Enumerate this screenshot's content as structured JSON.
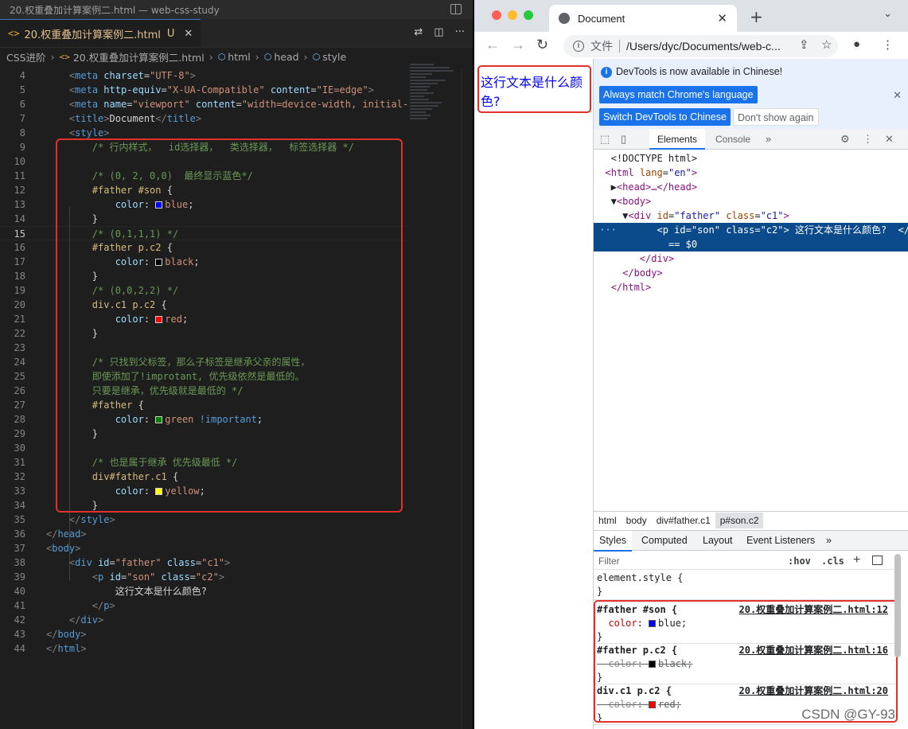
{
  "vscode": {
    "window_title": "20.权重叠加计算案例二.html — web-css-study",
    "tab": {
      "label": "20.权重叠加计算案例二.html",
      "status": "U",
      "icon": "<>"
    },
    "breadcrumb": [
      "CSS进阶",
      "20.权重叠加计算案例二.html",
      "html",
      "head",
      "style"
    ],
    "line_numbers": [
      "4",
      "5",
      "6",
      "7",
      "8",
      "9",
      "10",
      "11",
      "12",
      "13",
      "14",
      "15",
      "16",
      "17",
      "18",
      "19",
      "20",
      "21",
      "22",
      "23",
      "24",
      "25",
      "26",
      "27",
      "28",
      "29",
      "30",
      "31",
      "32",
      "33",
      "34",
      "35",
      "36",
      "37",
      "38",
      "39",
      "40",
      "41",
      "42",
      "43",
      "44"
    ],
    "code": {
      "l4_attr": "charset",
      "l4_val": "\"UTF-8\"",
      "l5_attr": "http-equiv",
      "l5_val": "\"X-UA-Compatible\"",
      "l5_attr2": "content",
      "l5_val2": "\"IE=edge\"",
      "l6_attr": "name",
      "l6_val": "\"viewport\"",
      "l6_attr2": "content",
      "l6_val2": "\"width=device-width, initial-",
      "l7_text": "Document",
      "c9": "/* 行内样式，  id选择器，  类选择器，  标签选择器 */",
      "c11": "/* (0, 2, 0,0)  最终显示蓝色*/",
      "s12": "#father #son",
      "v13": "blue",
      "c15": "/* (0,1,1,1) */",
      "s16": "#father p.c2",
      "v17": "black",
      "c19": "/* (0,0,2,2) */",
      "s20": "div.c1 p.c2",
      "v21": "red",
      "c24": "/* 只找到父标签，那么子标签是继承父亲的属性，",
      "c25": "即使添加了!improtant, 优先级依然是最低的。",
      "c26": "只要是继承，优先级就是最低的 */",
      "s27": "#father",
      "v28": "green",
      "imp28": "!important",
      "c31": "/* 也是属于继承 优先级最低 */",
      "s32": "div#father.c1",
      "v33": "yellow",
      "prop": "color",
      "l38_id": "\"father\"",
      "l38_cls": "\"c1\"",
      "l39_id": "\"son\"",
      "l39_cls": "\"c2\"",
      "l40_text": "这行文本是什么颜色?"
    },
    "colors": {
      "blue": "#0000ff",
      "black": "#000000",
      "red": "#ff0000",
      "green": "#008000",
      "yellow": "#ffff00",
      "highlight": "#e0312b"
    }
  },
  "browser": {
    "tab_title": "Document",
    "omnibox_prefix": "文件",
    "url": "/Users/dyc/Documents/web-c...",
    "page_text": "这行文本是什么颜色?"
  },
  "devtools": {
    "notice": "DevTools is now available in Chinese!",
    "btn_match": "Always match Chrome's language",
    "btn_switch": "Switch DevTools to Chinese",
    "btn_dont": "Don't show again",
    "tabs": {
      "elements": "Elements",
      "console": "Console"
    },
    "dom": {
      "doctype": "<!DOCTYPE html>",
      "html_open": "html",
      "lang_attr": "lang",
      "lang_val": "\"en\"",
      "head": "<head>…</head>",
      "body_open": "<body>",
      "div_id": "\"father\"",
      "div_cls": "\"c1\"",
      "p_id": "\"son\"",
      "p_cls": "\"c2\"",
      "p_text": "这行文本是什么颜色?",
      "p_eq": "== $0",
      "div_close": "</div>",
      "body_close": "</body>",
      "html_close": "</html>"
    },
    "breadcrumb": [
      "html",
      "body",
      "div#father.c1",
      "p#son.c2"
    ],
    "styles_tabs": [
      "Styles",
      "Computed",
      "Layout",
      "Event Listeners"
    ],
    "filter_placeholder": "Filter",
    "hov": ":hov",
    "cls": ".cls",
    "element_style": "element.style {",
    "rules": [
      {
        "selector": "#father #son {",
        "source": "20.权重叠加计算案例二.html:12",
        "prop": "color",
        "value": "blue;",
        "swatch": "#0000ff",
        "overridden": false
      },
      {
        "selector": "#father p.c2 {",
        "source": "20.权重叠加计算案例二.html:16",
        "prop": "color",
        "value": "black;",
        "swatch": "#000000",
        "overridden": true
      },
      {
        "selector": "div.c1 p.c2 {",
        "source": "20.权重叠加计算案例二.html:20",
        "prop": "color",
        "value": "red;",
        "swatch": "#ff0000",
        "overridden": true
      }
    ]
  },
  "watermark": "CSDN @GY-93"
}
